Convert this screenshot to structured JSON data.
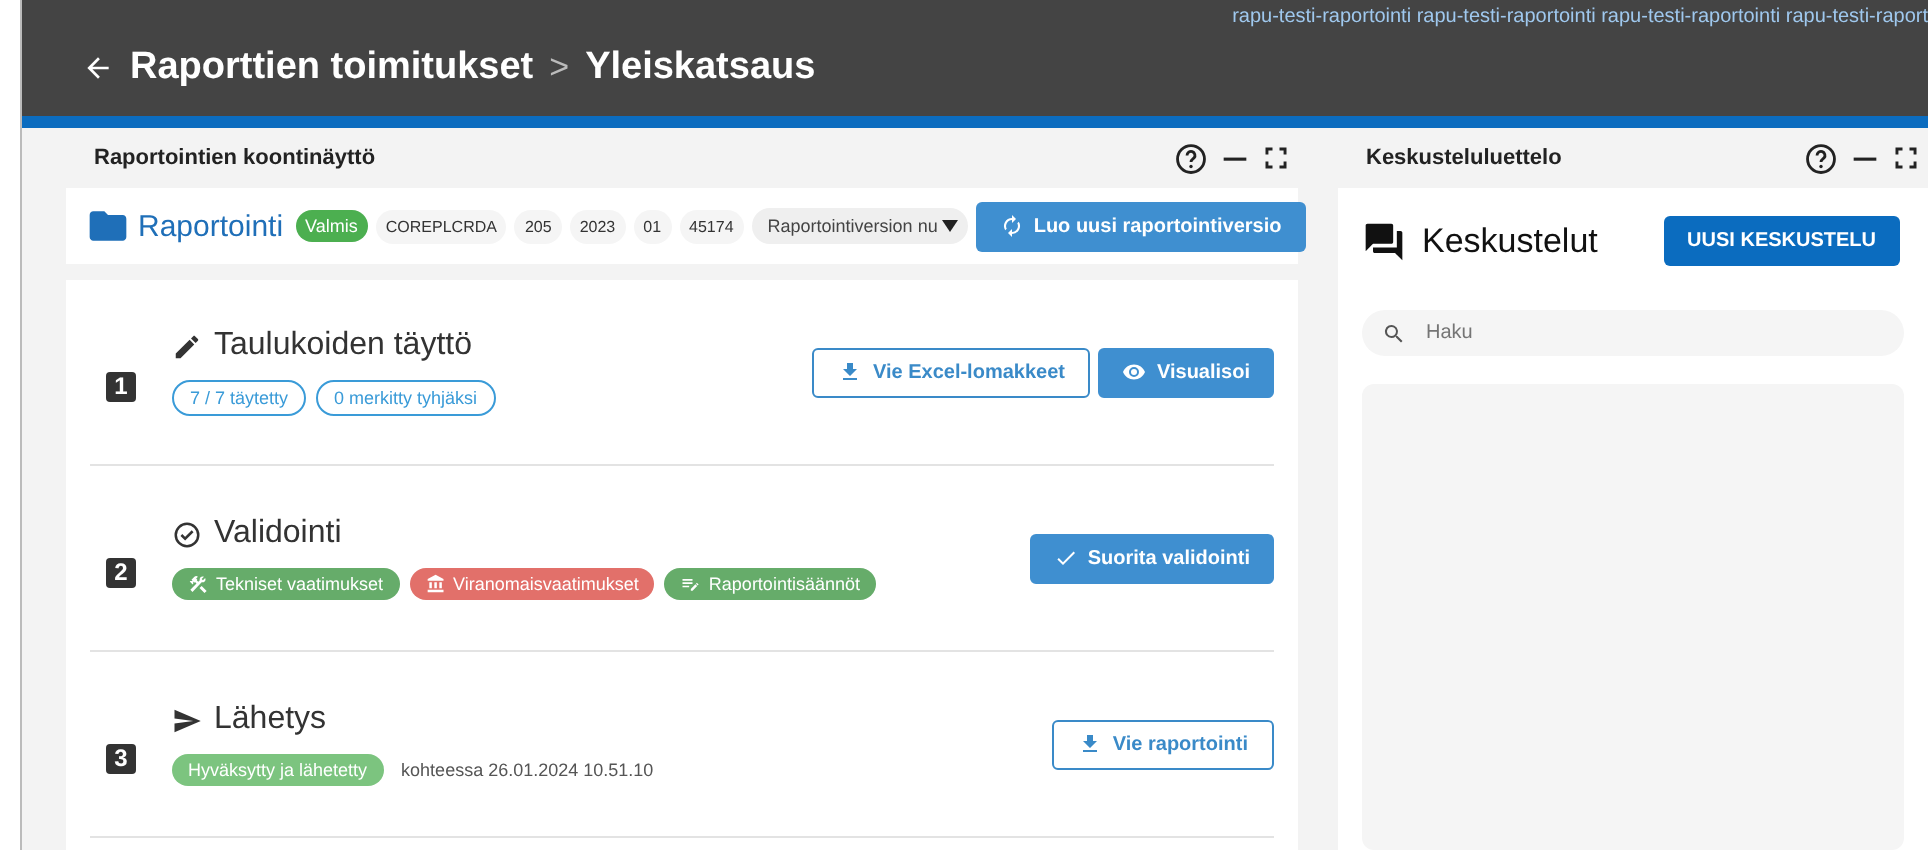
{
  "environment_label": "rapu-testi-raportointi rapu-testi-raportointi rapu-testi-raportointi rapu-testi-raport",
  "header": {
    "breadcrumb": "Raporttien toimitukset",
    "separator": ">",
    "current": "Yleiskatsaus"
  },
  "main_panel": {
    "title": "Raportointien koontinäyttö",
    "report": {
      "name": "Raportointi",
      "status": "Valmis",
      "chips": [
        "COREPLCRDA",
        "205",
        "2023",
        "01",
        "45174"
      ],
      "version_select": "Raportointiversion nu",
      "new_version_button": "Luo uusi raportointiversio"
    },
    "steps": [
      {
        "number": "1",
        "title": "Taulukoiden täyttö",
        "tags": [
          {
            "kind": "outline",
            "label": "7 / 7 täytetty",
            "color": "#3a9bd8"
          },
          {
            "kind": "outline",
            "label": "0 merkitty tyhjäksi",
            "color": "#3a9bd8"
          }
        ],
        "buttons": [
          {
            "kind": "outline",
            "label": "Vie Excel-lomakkeet"
          },
          {
            "kind": "filled",
            "label": "Visualisoi"
          }
        ]
      },
      {
        "number": "2",
        "title": "Validointi",
        "tags": [
          {
            "kind": "filled",
            "label": "Tekniset vaatimukset",
            "color": "#66ac6a"
          },
          {
            "kind": "filled",
            "label": "Viranomaisvaatimukset",
            "color": "#e2706a"
          },
          {
            "kind": "filled",
            "label": "Raportointisäännöt",
            "color": "#66ac6a"
          }
        ],
        "buttons": [
          {
            "kind": "filled",
            "label": "Suorita validointi"
          }
        ]
      },
      {
        "number": "3",
        "title": "Lähetys",
        "tags": [
          {
            "kind": "filled",
            "label": "Hyväksytty ja lähetetty",
            "color": "#7cc47f"
          }
        ],
        "note": "kohteessa 26.01.2024 10.51.10",
        "buttons": [
          {
            "kind": "outline",
            "label": "Vie raportointi"
          }
        ]
      }
    ]
  },
  "side_panel": {
    "title": "Keskusteluluettelo",
    "heading": "Keskustelut",
    "new_button": "UUSI KESKUSTELU",
    "search": {
      "placeholder": "Haku"
    }
  }
}
